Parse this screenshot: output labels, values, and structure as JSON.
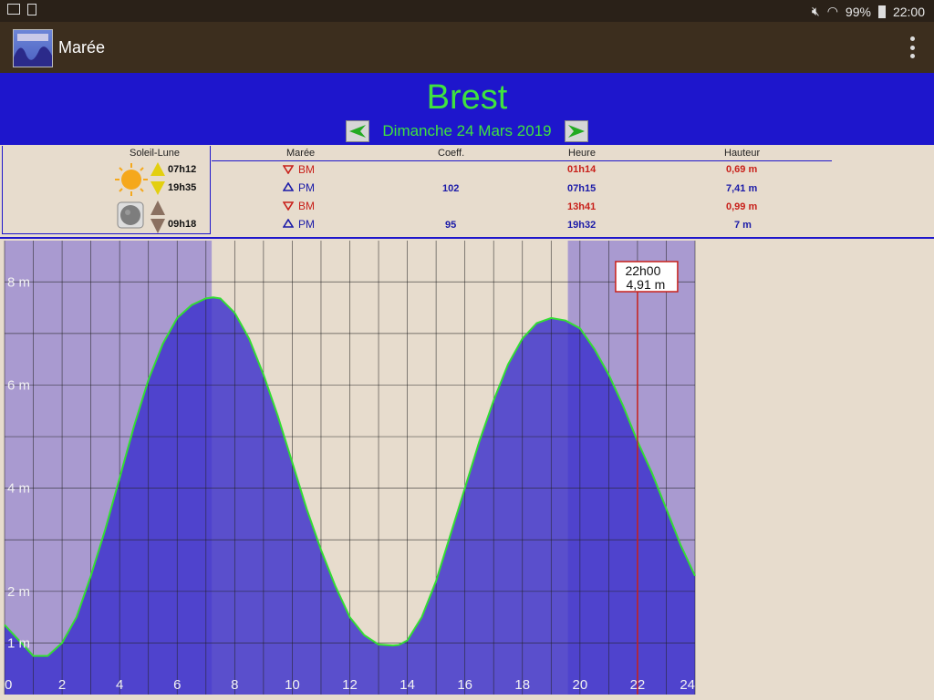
{
  "status": {
    "battery": "99%",
    "time": "22:00"
  },
  "app": {
    "title": "Marée"
  },
  "header": {
    "city": "Brest",
    "date": "Dimanche 24 Mars 2019"
  },
  "table": {
    "headers": {
      "soleil_lune": "Soleil-Lune",
      "maree": "Marée",
      "coeff": "Coeff.",
      "heure": "Heure",
      "hauteur": "Hauteur"
    },
    "sun": {
      "rise": "07h12",
      "set": "19h35"
    },
    "moon": {
      "rise": "09h18"
    },
    "tides": [
      {
        "type": "BM",
        "coeff": "",
        "time": "01h14",
        "height": "0,69 m"
      },
      {
        "type": "PM",
        "coeff": "102",
        "time": "07h15",
        "height": "7,41 m"
      },
      {
        "type": "BM",
        "coeff": "",
        "time": "13h41",
        "height": "0,99 m"
      },
      {
        "type": "PM",
        "coeff": "95",
        "time": "19h32",
        "height": "7 m"
      }
    ]
  },
  "colors": {
    "water": "#3a2fcc",
    "curve": "#33dd33",
    "night": "#a99ad0",
    "day": "#e7dccd",
    "header": "#1e16cc",
    "cursor": "#c8201a"
  },
  "chart_data": {
    "type": "area",
    "xlim": [
      0,
      24
    ],
    "ylim": [
      0,
      8.8
    ],
    "x_ticks": [
      "0",
      "2",
      "4",
      "6",
      "8",
      "10",
      "12",
      "14",
      "16",
      "18",
      "20",
      "22",
      "24"
    ],
    "y_ticks": [
      "1 m",
      "2 m",
      "4 m",
      "6 m",
      "8 m"
    ],
    "y_tick_values": [
      1,
      2,
      4,
      6,
      8
    ],
    "night_periods": [
      [
        0,
        7.2
      ],
      [
        19.58,
        24
      ]
    ],
    "series": [
      {
        "x": [
          0,
          0.5,
          1,
          1.5,
          2,
          2.5,
          3,
          3.5,
          4,
          4.5,
          5,
          5.5,
          6,
          6.5,
          7,
          7.25,
          7.5,
          8,
          8.5,
          9,
          9.5,
          10,
          10.5,
          11,
          11.5,
          12,
          12.5,
          13,
          13.5,
          13.7,
          14,
          14.5,
          15,
          15.5,
          16,
          16.5,
          17,
          17.5,
          18,
          18.5,
          19,
          19.5,
          20,
          20.5,
          21,
          21.5,
          22,
          22.5,
          23,
          23.5,
          24
        ],
        "y": [
          1.35,
          1.05,
          0.75,
          0.75,
          1.0,
          1.5,
          2.3,
          3.2,
          4.2,
          5.2,
          6.1,
          6.8,
          7.3,
          7.55,
          7.68,
          7.7,
          7.68,
          7.4,
          6.9,
          6.2,
          5.4,
          4.5,
          3.6,
          2.8,
          2.1,
          1.5,
          1.15,
          0.97,
          0.95,
          0.96,
          1.05,
          1.5,
          2.2,
          3.1,
          4.0,
          4.9,
          5.7,
          6.4,
          6.9,
          7.2,
          7.3,
          7.25,
          7.1,
          6.7,
          6.2,
          5.6,
          4.91,
          4.3,
          3.6,
          2.9,
          2.3
        ]
      }
    ],
    "cursor": {
      "x": 22,
      "label_time": "22h00",
      "label_height": "4,91 m"
    }
  }
}
